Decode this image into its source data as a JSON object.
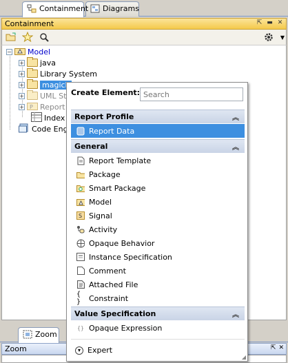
{
  "tabs": [
    {
      "label": "Containment"
    },
    {
      "label": "Diagrams"
    }
  ],
  "panel": {
    "title": "Containment"
  },
  "tree": {
    "root": "Model",
    "children": [
      "java",
      "Library System",
      "magicli",
      "UML St",
      "Report",
      "Index"
    ],
    "code_engineering": "Code Engin"
  },
  "popup": {
    "create_label": "Create Element:",
    "search_placeholder": "Search",
    "sections": [
      {
        "title": "Report Profile",
        "items": [
          {
            "label": "Report Data"
          }
        ]
      },
      {
        "title": "General",
        "items": [
          {
            "label": "Report Template"
          },
          {
            "label": "Package"
          },
          {
            "label": "Smart Package"
          },
          {
            "label": "Model"
          },
          {
            "label": "Signal"
          },
          {
            "label": "Activity"
          },
          {
            "label": "Opaque Behavior"
          },
          {
            "label": "Instance Specification"
          },
          {
            "label": "Comment"
          },
          {
            "label": "Attached File"
          },
          {
            "label": "Constraint"
          }
        ]
      },
      {
        "title": "Value Specification",
        "items": [
          {
            "label": "Opaque Expression"
          }
        ]
      }
    ],
    "expert": "Expert"
  },
  "zoom": {
    "tab": "Zoom",
    "title": "Zoom"
  },
  "colors": {
    "title_bar": "#f4c94b",
    "selection": "#3d8fe0",
    "tree_link": "#0000cc"
  }
}
